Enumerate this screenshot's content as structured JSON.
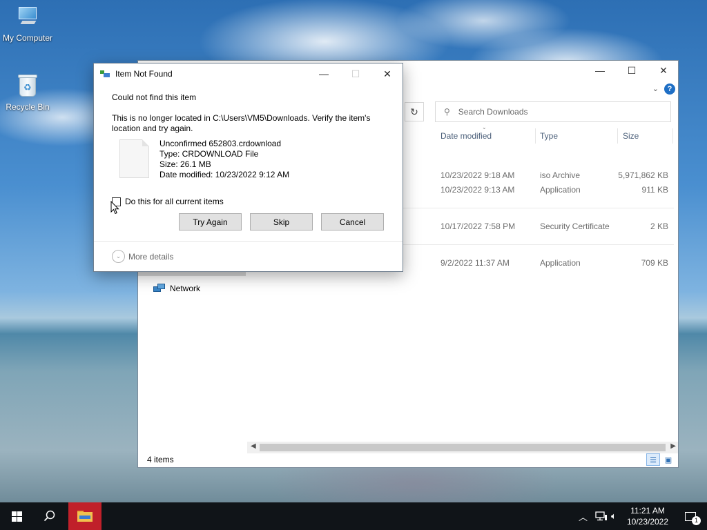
{
  "desktop": {
    "icons": [
      {
        "label": "My Computer"
      },
      {
        "label": "Recycle Bin"
      }
    ]
  },
  "explorer": {
    "search_placeholder": "Search Downloads",
    "nav": {
      "network_label": "Network"
    },
    "columns": {
      "date": "Date modified",
      "type": "Type",
      "size": "Size"
    },
    "rows": [
      {
        "date": "10/23/2022 9:18 AM",
        "type": "iso Archive",
        "size": "5,971,862 KB"
      },
      {
        "date": "10/23/2022 9:13 AM",
        "type": "Application",
        "size": "911 KB"
      },
      {
        "date": "10/17/2022 7:58 PM",
        "type": "Security Certificate",
        "size": "2 KB"
      },
      {
        "date": "9/2/2022 11:37 AM",
        "type": "Application",
        "size": "709 KB"
      }
    ],
    "status": "4 items"
  },
  "dialog": {
    "title": "Item Not Found",
    "heading": "Could not find this item",
    "message_line1": "This is no longer located in C:\\Users\\VM5\\Downloads. Verify the item's",
    "message_line2": "location and try again.",
    "file": {
      "name": "Unconfirmed 652803.crdownload",
      "type": "Type: CRDOWNLOAD File",
      "size": "Size: 26.1 MB",
      "date": "Date modified: 10/23/2022 9:12 AM"
    },
    "checkbox_label": "Do this for all current items",
    "checkbox_checked": false,
    "buttons": {
      "try_again": "Try Again",
      "skip": "Skip",
      "cancel": "Cancel"
    },
    "more_details": "More details"
  },
  "taskbar": {
    "time": "11:21 AM",
    "date": "10/23/2022",
    "notification_count": "1"
  }
}
